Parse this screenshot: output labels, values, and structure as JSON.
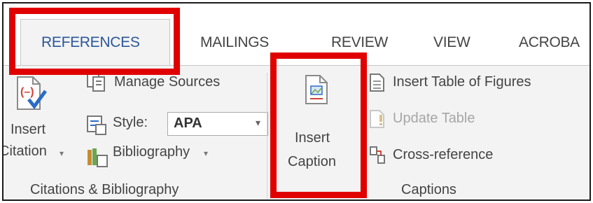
{
  "tabs": [
    "REFERENCES",
    "MAILINGS",
    "REVIEW",
    "VIEW",
    "ACROBA"
  ],
  "citations_group": {
    "insert_citation_line1": "Insert",
    "insert_citation_line2": "Citation",
    "manage_sources": "Manage Sources",
    "style_label": "Style:",
    "style_value": "APA",
    "bibliography": "Bibliography",
    "group_label": "Citations & Bibliography"
  },
  "captions_group": {
    "insert_caption_line1": "Insert",
    "insert_caption_line2": "Caption",
    "insert_table_of_figures": "Insert Table of Figures",
    "update_table": "Update Table",
    "cross_reference": "Cross-reference",
    "group_label": "Captions"
  },
  "colors": {
    "accent": "#2b579a",
    "highlight": "#e00000"
  },
  "icons": [
    "insert-citation-icon",
    "manage-sources-icon",
    "style-icon",
    "bibliography-icon",
    "insert-caption-icon",
    "insert-table-of-figures-icon",
    "update-table-icon",
    "cross-reference-icon",
    "dropdown-caret-icon"
  ]
}
